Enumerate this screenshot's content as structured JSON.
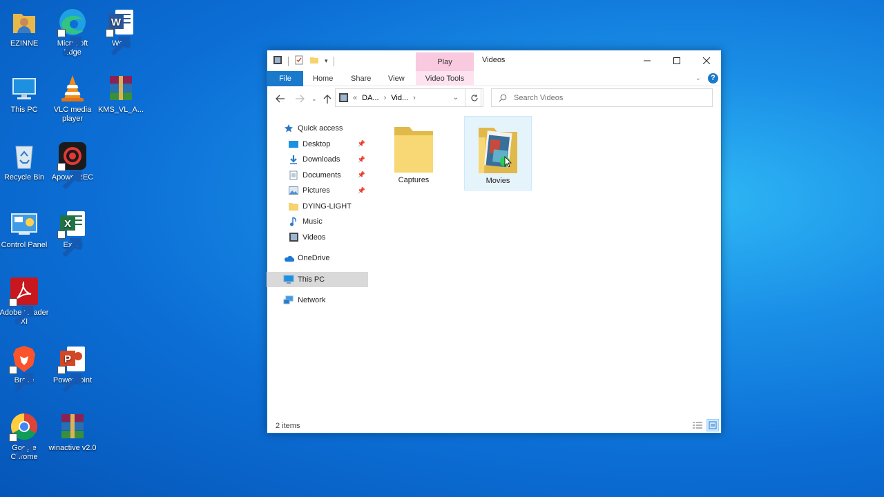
{
  "desktop": {
    "icons": [
      {
        "label": "EZINNE"
      },
      {
        "label": "Microsoft Edge"
      },
      {
        "label": "Word"
      },
      {
        "label": "This PC"
      },
      {
        "label": "VLC media player"
      },
      {
        "label": "KMS_VL_A..."
      },
      {
        "label": "Recycle Bin"
      },
      {
        "label": "ApowerREC"
      },
      {
        "label": "Control Panel"
      },
      {
        "label": "Excel"
      },
      {
        "label": "Adobe Reader XI"
      },
      {
        "label": "Brave"
      },
      {
        "label": "PowerPoint"
      },
      {
        "label": "Google Chrome"
      },
      {
        "label": "winactive v2.0"
      }
    ]
  },
  "window": {
    "title": "Videos",
    "contextual_tab": "Play",
    "ribbon_tabs": {
      "file": "File",
      "home": "Home",
      "share": "Share",
      "view": "View",
      "video_tools": "Video Tools"
    },
    "address": {
      "segment1": "DA...",
      "segment2": "Vid...",
      "prefix": "«"
    },
    "search_placeholder": "Search Videos",
    "nav": {
      "quick_access": "Quick access",
      "desktop": "Desktop",
      "downloads": "Downloads",
      "documents": "Documents",
      "pictures": "Pictures",
      "dying_light": "DYING-LIGHT",
      "music": "Music",
      "videos": "Videos",
      "onedrive": "OneDrive",
      "this_pc": "This PC",
      "network": "Network"
    },
    "items": [
      {
        "name": "Captures"
      },
      {
        "name": "Movies"
      }
    ],
    "status": "2 items"
  },
  "colors": {
    "accent": "#1979ca",
    "folder": "#f5d36f",
    "play_tab": "#f9c9df"
  }
}
